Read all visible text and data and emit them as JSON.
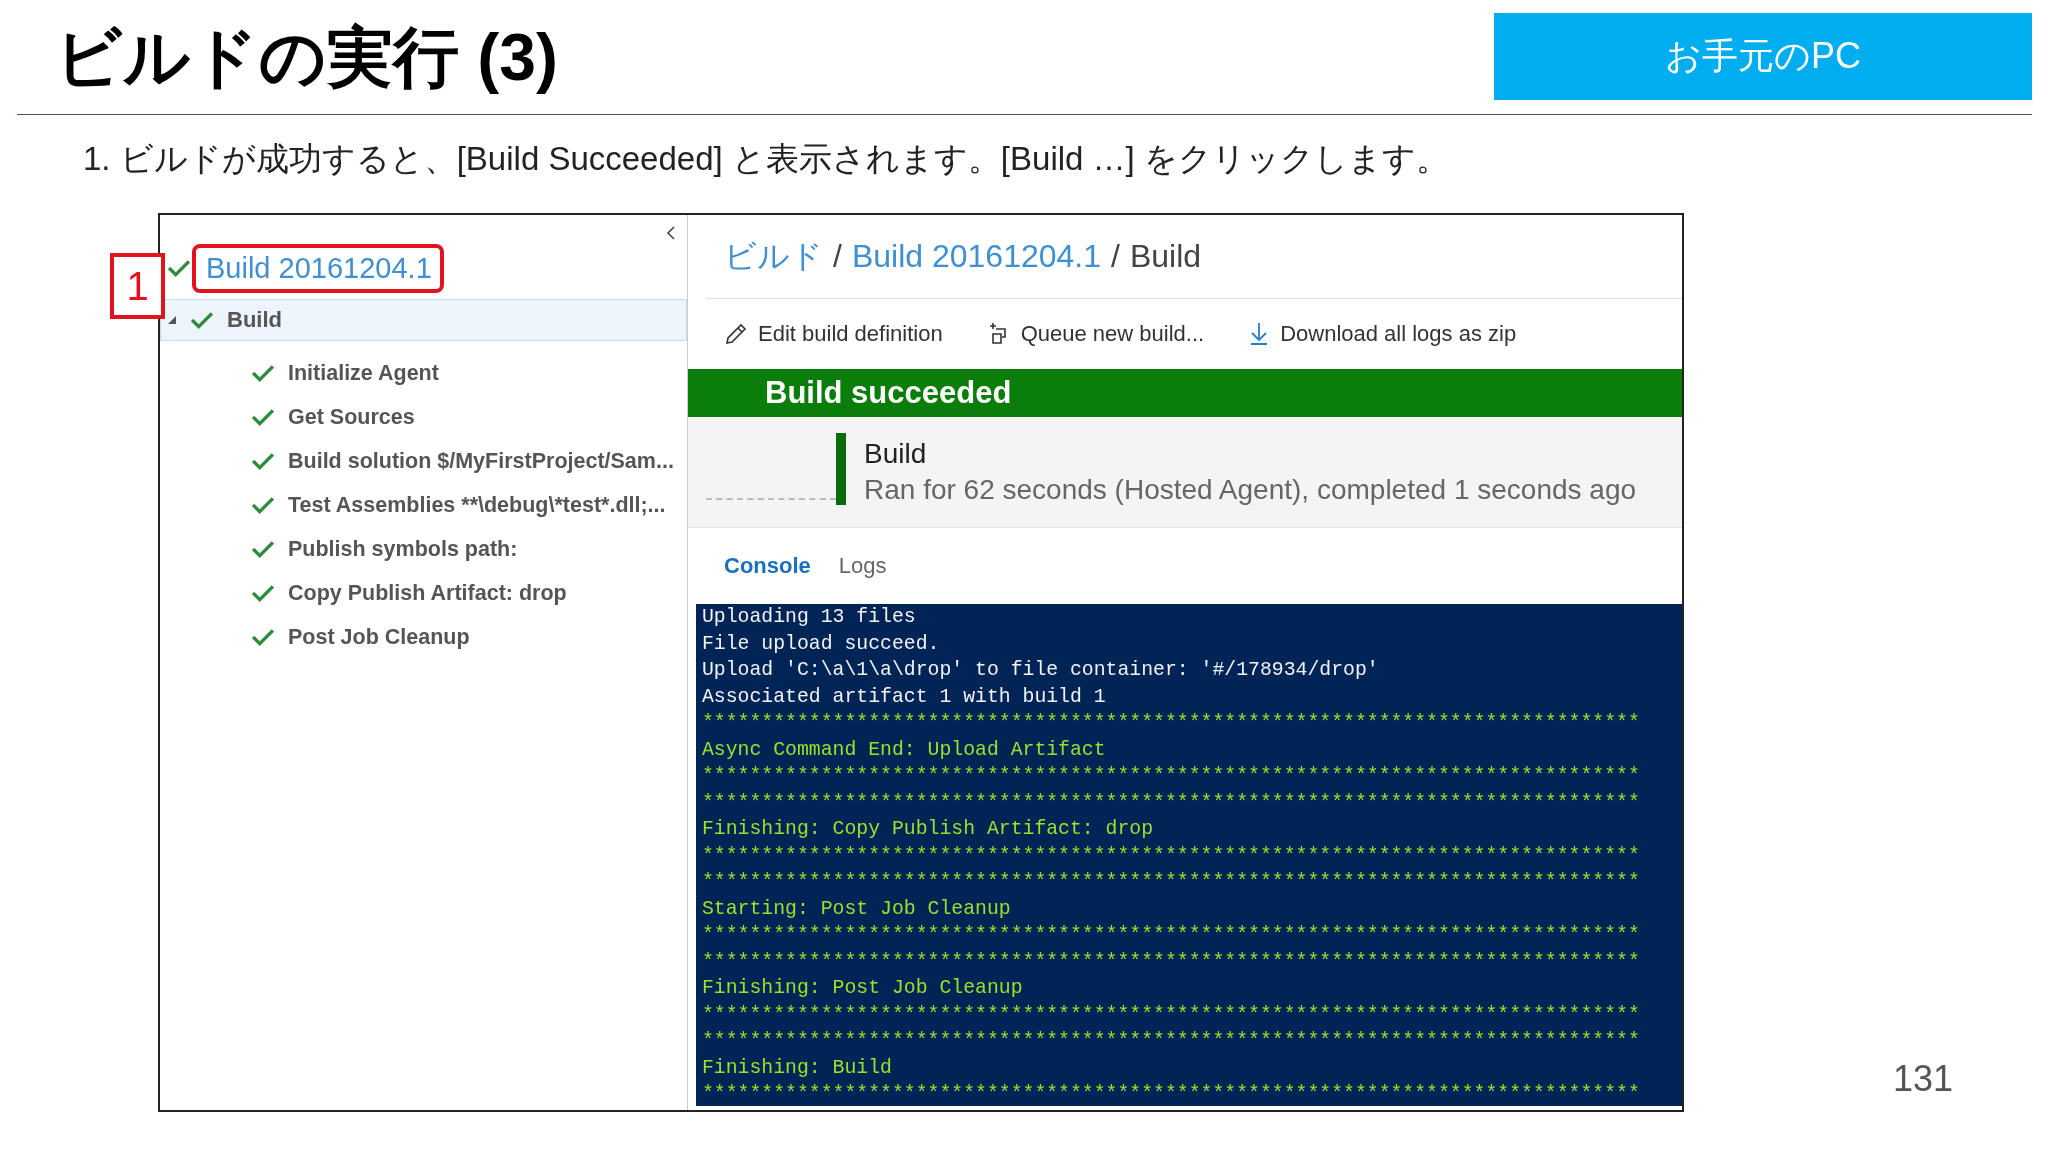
{
  "slide": {
    "title": "ビルドの実行 (3)",
    "badge": "お手元のPC",
    "instruction": "1.  ビルドが成功すると、[Build Succeeded] と表示されます。[Build …] をクリックします。",
    "page_number": "131"
  },
  "annotation": {
    "label": "1"
  },
  "build_tree": {
    "build": {
      "name": "Build 20161204.1"
    },
    "job": {
      "name": "Build",
      "expanded": true,
      "selected": true,
      "steps": [
        {
          "label": "Initialize Agent"
        },
        {
          "label": "Get Sources"
        },
        {
          "label": "Build solution $/MyFirstProject/Sam..."
        },
        {
          "label": "Test Assemblies **\\debug\\*test*.dll;..."
        },
        {
          "label": "Publish symbols path:"
        },
        {
          "label": "Copy Publish Artifact: drop"
        },
        {
          "label": "Post Job Cleanup"
        }
      ]
    }
  },
  "detail": {
    "breadcrumb": [
      {
        "label": "ビルド",
        "kind": "link"
      },
      {
        "label": "Build 20161204.1",
        "kind": "link"
      },
      {
        "label": "Build",
        "kind": "current"
      }
    ],
    "separator": "/",
    "toolbar": [
      {
        "label": "Edit build definition",
        "kind": "edit"
      },
      {
        "label": "Queue new build...",
        "kind": "queue"
      },
      {
        "label": "Download all logs as zip",
        "kind": "download"
      }
    ],
    "banner": "Build succeeded",
    "summary": {
      "name": "Build",
      "detail": "Ran for 62 seconds (Hosted Agent), completed 1 seconds ago"
    },
    "tabs": [
      {
        "label": "Console",
        "selected": true
      },
      {
        "label": "Logs",
        "selected": false
      }
    ],
    "console": [
      {
        "text": "Uploading 13 files",
        "kind": "plain"
      },
      {
        "text": "File upload succeed.",
        "kind": "plain"
      },
      {
        "text": "Upload 'C:\\a\\1\\a\\drop' to file container: '#/178934/drop'",
        "kind": "plain"
      },
      {
        "text": "Associated artifact 1 with build 1",
        "kind": "plain"
      },
      {
        "text": "*******************************************************************************",
        "kind": "section"
      },
      {
        "text": "Async Command End: Upload Artifact",
        "kind": "section"
      },
      {
        "text": "*******************************************************************************",
        "kind": "section"
      },
      {
        "text": "*******************************************************************************",
        "kind": "section"
      },
      {
        "text": "Finishing: Copy Publish Artifact: drop",
        "kind": "section"
      },
      {
        "text": "*******************************************************************************",
        "kind": "section"
      },
      {
        "text": "*******************************************************************************",
        "kind": "section"
      },
      {
        "text": "Starting: Post Job Cleanup",
        "kind": "section"
      },
      {
        "text": "*******************************************************************************",
        "kind": "section"
      },
      {
        "text": "*******************************************************************************",
        "kind": "section"
      },
      {
        "text": "Finishing: Post Job Cleanup",
        "kind": "section"
      },
      {
        "text": "*******************************************************************************",
        "kind": "section"
      },
      {
        "text": "*******************************************************************************",
        "kind": "section"
      },
      {
        "text": "Finishing: Build",
        "kind": "section"
      },
      {
        "text": "*******************************************************************************",
        "kind": "section"
      }
    ]
  }
}
